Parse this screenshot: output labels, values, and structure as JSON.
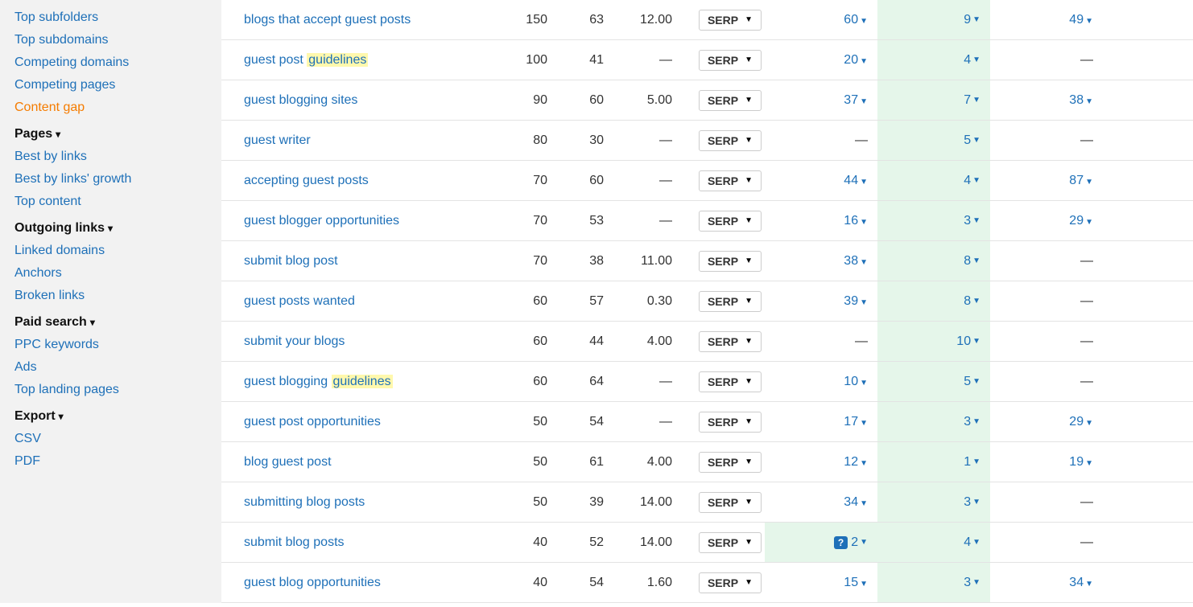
{
  "sidebar": {
    "top_links": [
      {
        "label": "Top subfolders"
      },
      {
        "label": "Top subdomains"
      },
      {
        "label": "Competing domains"
      },
      {
        "label": "Competing pages"
      },
      {
        "label": "Content gap",
        "active": true
      }
    ],
    "sections": [
      {
        "title": "Pages",
        "items": [
          {
            "label": "Best by links"
          },
          {
            "label": "Best by links' growth"
          },
          {
            "label": "Top content"
          }
        ]
      },
      {
        "title": "Outgoing links",
        "items": [
          {
            "label": "Linked domains"
          },
          {
            "label": "Anchors"
          },
          {
            "label": "Broken links"
          }
        ]
      },
      {
        "title": "Paid search",
        "items": [
          {
            "label": "PPC keywords"
          },
          {
            "label": "Ads"
          },
          {
            "label": "Top landing pages"
          }
        ]
      },
      {
        "title": "Export",
        "items": [
          {
            "label": "CSV"
          },
          {
            "label": "PDF"
          }
        ]
      }
    ]
  },
  "serp_label": "SERP",
  "rows": [
    {
      "kw_pre": "blogs that accept guest posts",
      "kw_hl": "",
      "vol": "150",
      "kd": "63",
      "cpc": "12.00",
      "v1": "60",
      "v2": "9",
      "v3": "49"
    },
    {
      "kw_pre": "guest post ",
      "kw_hl": "guidelines",
      "vol": "100",
      "kd": "41",
      "cpc": "—",
      "v1": "20",
      "v2": "4",
      "v3": "—"
    },
    {
      "kw_pre": "guest blogging sites",
      "kw_hl": "",
      "vol": "90",
      "kd": "60",
      "cpc": "5.00",
      "v1": "37",
      "v2": "7",
      "v3": "38"
    },
    {
      "kw_pre": "guest writer",
      "kw_hl": "",
      "vol": "80",
      "kd": "30",
      "cpc": "—",
      "v1": "—",
      "v2": "5",
      "v3": "—"
    },
    {
      "kw_pre": "accepting guest posts",
      "kw_hl": "",
      "vol": "70",
      "kd": "60",
      "cpc": "—",
      "v1": "44",
      "v2": "4",
      "v3": "87"
    },
    {
      "kw_pre": "guest blogger opportunities",
      "kw_hl": "",
      "vol": "70",
      "kd": "53",
      "cpc": "—",
      "v1": "16",
      "v2": "3",
      "v3": "29"
    },
    {
      "kw_pre": "submit blog post",
      "kw_hl": "",
      "vol": "70",
      "kd": "38",
      "cpc": "11.00",
      "v1": "38",
      "v2": "8",
      "v3": "—"
    },
    {
      "kw_pre": "guest posts wanted",
      "kw_hl": "",
      "vol": "60",
      "kd": "57",
      "cpc": "0.30",
      "v1": "39",
      "v2": "8",
      "v3": "—"
    },
    {
      "kw_pre": "submit your blogs",
      "kw_hl": "",
      "vol": "60",
      "kd": "44",
      "cpc": "4.00",
      "v1": "—",
      "v2": "10",
      "v3": "—"
    },
    {
      "kw_pre": "guest blogging ",
      "kw_hl": "guidelines",
      "vol": "60",
      "kd": "64",
      "cpc": "—",
      "v1": "10",
      "v2": "5",
      "v3": "—"
    },
    {
      "kw_pre": "guest post opportunities",
      "kw_hl": "",
      "vol": "50",
      "kd": "54",
      "cpc": "—",
      "v1": "17",
      "v2": "3",
      "v3": "29"
    },
    {
      "kw_pre": "blog guest post",
      "kw_hl": "",
      "vol": "50",
      "kd": "61",
      "cpc": "4.00",
      "v1": "12",
      "v2": "1",
      "v3": "19"
    },
    {
      "kw_pre": "submitting blog posts",
      "kw_hl": "",
      "vol": "50",
      "kd": "39",
      "cpc": "14.00",
      "v1": "34",
      "v2": "3",
      "v3": "—"
    },
    {
      "kw_pre": "submit blog posts",
      "kw_hl": "",
      "vol": "40",
      "kd": "52",
      "cpc": "14.00",
      "v1": "2",
      "v1_badge": true,
      "v1_hl": true,
      "v2": "4",
      "v3": "—"
    },
    {
      "kw_pre": "guest blog opportunities",
      "kw_hl": "",
      "vol": "40",
      "kd": "54",
      "cpc": "1.60",
      "v1": "15",
      "v2": "3",
      "v3": "34"
    }
  ]
}
